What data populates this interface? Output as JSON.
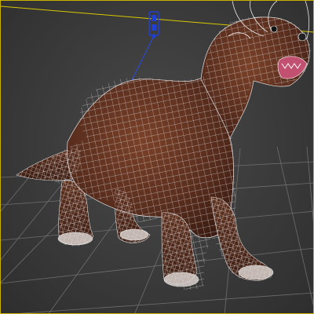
{
  "viewport": {
    "kind": "3d-perspective-viewport",
    "display_mode": "wireframe-over-shaded",
    "active": true
  },
  "scene_objects": [
    {
      "name": "otter-model",
      "mesh_color": "#5a2e1e",
      "wire_color": "#e8e8e8"
    },
    {
      "name": "light-helper",
      "color": "#1f3fd6"
    },
    {
      "name": "target-line",
      "color": "#d8c800"
    }
  ],
  "colors": {
    "grid": "#6e6e6e",
    "viewport_border": "#c9b200",
    "background": "#3d3d3d"
  }
}
